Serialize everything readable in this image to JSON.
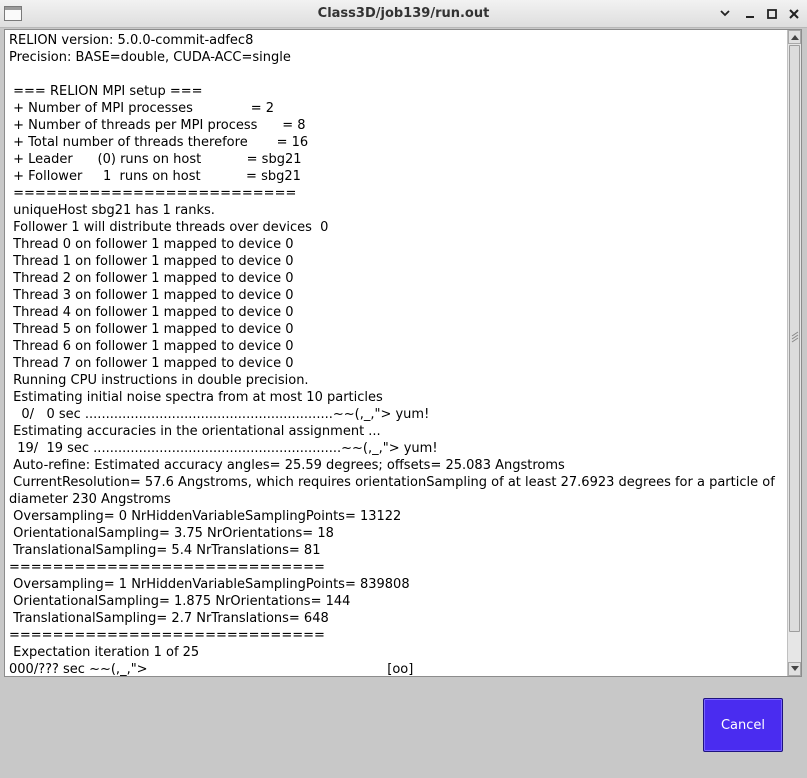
{
  "window": {
    "title": "Class3D/job139/run.out",
    "icons": [
      "app-window-icon",
      "minimize-icon",
      "restore-icon",
      "maximize-icon",
      "close-icon"
    ]
  },
  "log": {
    "lines": [
      "RELION version: 5.0.0-commit-adfec8",
      "Precision: BASE=double, CUDA-ACC=single",
      "",
      " === RELION MPI setup ===",
      " + Number of MPI processes              = 2",
      " + Number of threads per MPI process      = 8",
      " + Total number of threads therefore       = 16",
      " + Leader      (0) runs on host           = sbg21",
      " + Follower     1  runs on host           = sbg21",
      " ==========================",
      " uniqueHost sbg21 has 1 ranks.",
      " Follower 1 will distribute threads over devices  0",
      " Thread 0 on follower 1 mapped to device 0",
      " Thread 1 on follower 1 mapped to device 0",
      " Thread 2 on follower 1 mapped to device 0",
      " Thread 3 on follower 1 mapped to device 0",
      " Thread 4 on follower 1 mapped to device 0",
      " Thread 5 on follower 1 mapped to device 0",
      " Thread 6 on follower 1 mapped to device 0",
      " Thread 7 on follower 1 mapped to device 0",
      " Running CPU instructions in double precision.",
      " Estimating initial noise spectra from at most 10 particles",
      "   0/   0 sec ............................................................~~(,_,\"> yum!",
      " Estimating accuracies in the orientational assignment ...",
      "  19/  19 sec ............................................................~~(,_,\"> yum!",
      " Auto-refine: Estimated accuracy angles= 25.59 degrees; offsets= 25.083 Angstroms",
      " CurrentResolution= 57.6 Angstroms, which requires orientationSampling of at least 27.6923 degrees for a particle of diameter 230 Angstroms",
      " Oversampling= 0 NrHiddenVariableSamplingPoints= 13122",
      " OrientationalSampling= 3.75 NrOrientations= 18",
      " TranslationalSampling= 5.4 NrTranslations= 81",
      "=============================",
      " Oversampling= 1 NrHiddenVariableSamplingPoints= 839808",
      " OrientationalSampling= 1.875 NrOrientations= 144",
      " TranslationalSampling= 2.7 NrTranslations= 648",
      "=============================",
      " Expectation iteration 1 of 25",
      "000/??? sec ~~(,_,\">                                                          [oo]"
    ]
  },
  "footer": {
    "cancel_label": "Cancel"
  },
  "colors": {
    "cancel_bg": "#4a2cf0",
    "panel_bg": "#c8c8c8"
  }
}
